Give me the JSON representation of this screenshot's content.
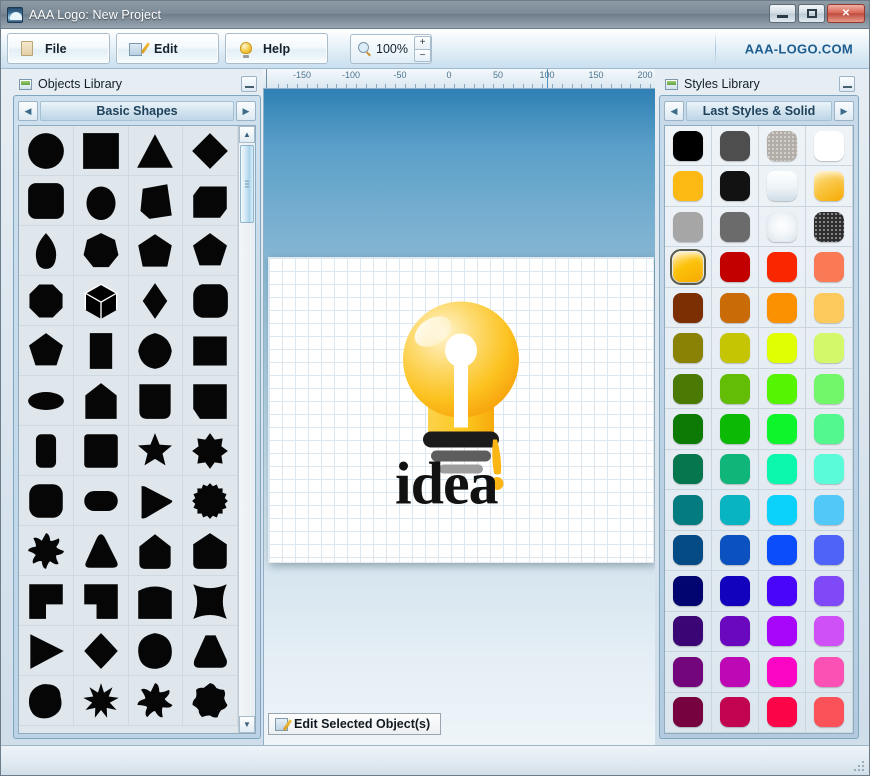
{
  "window": {
    "title": "AAA Logo: New Project",
    "icon": "app-logo-icon",
    "minimize_label": "",
    "maximize_label": "",
    "close_label": "✕"
  },
  "toolbar": {
    "buttons": [
      {
        "label": "File",
        "icon": "file-icon"
      },
      {
        "label": "Edit",
        "icon": "edit-pencil-icon"
      },
      {
        "label": "Help",
        "icon": "lightbulb-help-icon"
      }
    ],
    "zoom": {
      "icon": "magnifier-icon",
      "value": "100%",
      "increase": "+",
      "decrease": "−"
    },
    "brand": "AAA-LOGO.COM"
  },
  "objects_panel": {
    "title": "Objects Library",
    "icon": "library-icon",
    "collapse_label": "",
    "category": {
      "prev": "◀",
      "name": "Basic Shapes",
      "next": "▶"
    },
    "scrollbar": {
      "up": "▲",
      "down": "▼"
    },
    "shapes": [
      "circle",
      "square",
      "triangle",
      "diamond",
      "rounded-square",
      "egg",
      "cube-face",
      "slanted-hexagon",
      "teardrop",
      "heptagon",
      "pentagon-rounded",
      "pentagon",
      "octagon",
      "cube-3d",
      "rhombus",
      "rounded-octagon",
      "pentagon-wide",
      "rectangle-vertical",
      "hexagon-round",
      "rectangle-wide",
      "ellipse",
      "home-plate",
      "trapezoid-cup",
      "folded-square",
      "rounded-rect-tall",
      "square-rounded",
      "star-5",
      "star-8-blunt",
      "squircle",
      "pill-horizontal",
      "play-triangle",
      "gear-circle",
      "star-8-round",
      "triangle-rounded",
      "house",
      "shield",
      "step-corner",
      "step-notch",
      "arch-block",
      "concave-square",
      "arrow-right",
      "diamond-rounded",
      "blob-circle",
      "triangle-wide",
      "blob-petal",
      "star-9-sharp",
      "star-7-wave",
      "flower-blob"
    ]
  },
  "styles_panel": {
    "title": "Styles Library",
    "icon": "library-icon",
    "collapse_label": "",
    "category": {
      "prev": "◀",
      "name": "Last Styles & Solid",
      "next": "▶"
    },
    "swatches": [
      {
        "name": "black",
        "color": "#000000",
        "style": "solid",
        "selected": false
      },
      {
        "name": "dark-gray",
        "color": "#4e4e4e",
        "style": "solid",
        "selected": false
      },
      {
        "name": "light-gray-speck",
        "color": "#b2aea7",
        "style": "textured",
        "selected": false
      },
      {
        "name": "white",
        "color": "#ffffff",
        "style": "solid",
        "selected": false
      },
      {
        "name": "amber",
        "color": "#fdb913",
        "style": "solid",
        "selected": false
      },
      {
        "name": "near-black",
        "color": "#121212",
        "style": "solid",
        "selected": false
      },
      {
        "name": "white-gradient",
        "color": "#ffffff",
        "style": "gradient",
        "selected": false
      },
      {
        "name": "gold-gloss",
        "color": "#f9c747",
        "style": "gloss",
        "selected": false
      },
      {
        "name": "mid-gray",
        "color": "#a6a6a6",
        "style": "solid",
        "selected": false
      },
      {
        "name": "slate-gray",
        "color": "#6b6b6b",
        "style": "solid",
        "selected": false
      },
      {
        "name": "white-radial",
        "color": "#ffffff",
        "style": "radial",
        "selected": false
      },
      {
        "name": "charcoal-dots",
        "color": "#2e2e2e",
        "style": "textured",
        "selected": false
      },
      {
        "name": "gold-selected",
        "color": "#fcc20a",
        "style": "gloss",
        "selected": true
      },
      {
        "name": "dark-red",
        "color": "#c20000",
        "style": "solid",
        "selected": false
      },
      {
        "name": "red",
        "color": "#fa2600",
        "style": "solid",
        "selected": false
      },
      {
        "name": "salmon",
        "color": "#fa7a55",
        "style": "solid",
        "selected": false
      },
      {
        "name": "dark-brown",
        "color": "#7c2f02",
        "style": "solid",
        "selected": false
      },
      {
        "name": "burnt-orange",
        "color": "#c96b06",
        "style": "solid",
        "selected": false
      },
      {
        "name": "orange",
        "color": "#fb9000",
        "style": "solid",
        "selected": false
      },
      {
        "name": "light-orange",
        "color": "#fcc95c",
        "style": "solid",
        "selected": false
      },
      {
        "name": "olive",
        "color": "#8a8204",
        "style": "solid",
        "selected": false
      },
      {
        "name": "yellow-olive",
        "color": "#c6c504",
        "style": "solid",
        "selected": false
      },
      {
        "name": "chartreuse",
        "color": "#e0ff00",
        "style": "solid",
        "selected": false
      },
      {
        "name": "light-chartreuse",
        "color": "#d3f96a",
        "style": "solid",
        "selected": false
      },
      {
        "name": "dark-olive-green",
        "color": "#4a7a04",
        "style": "solid",
        "selected": false
      },
      {
        "name": "apple-green",
        "color": "#62bd04",
        "style": "solid",
        "selected": false
      },
      {
        "name": "bright-green",
        "color": "#55f400",
        "style": "solid",
        "selected": false
      },
      {
        "name": "light-green",
        "color": "#73f76a",
        "style": "solid",
        "selected": false
      },
      {
        "name": "forest-green",
        "color": "#0d7a06",
        "style": "solid",
        "selected": false
      },
      {
        "name": "green",
        "color": "#0cba05",
        "style": "solid",
        "selected": false
      },
      {
        "name": "lime",
        "color": "#0ef62b",
        "style": "solid",
        "selected": false
      },
      {
        "name": "mint",
        "color": "#52f88e",
        "style": "solid",
        "selected": false
      },
      {
        "name": "sea-green",
        "color": "#05764d",
        "style": "solid",
        "selected": false
      },
      {
        "name": "emerald",
        "color": "#10b57a",
        "style": "solid",
        "selected": false
      },
      {
        "name": "spring-green",
        "color": "#0bf7ab",
        "style": "solid",
        "selected": false
      },
      {
        "name": "aquamarine",
        "color": "#59fbd9",
        "style": "solid",
        "selected": false
      },
      {
        "name": "teal",
        "color": "#047b7e",
        "style": "solid",
        "selected": false
      },
      {
        "name": "dark-cyan",
        "color": "#09b4c2",
        "style": "solid",
        "selected": false
      },
      {
        "name": "cyan",
        "color": "#0ad2fb",
        "style": "solid",
        "selected": false
      },
      {
        "name": "sky-blue",
        "color": "#52c8f8",
        "style": "solid",
        "selected": false
      },
      {
        "name": "navy-blue",
        "color": "#044a84",
        "style": "solid",
        "selected": false
      },
      {
        "name": "medium-blue",
        "color": "#0b52c0",
        "style": "solid",
        "selected": false
      },
      {
        "name": "blue",
        "color": "#0b4cfb",
        "style": "solid",
        "selected": false
      },
      {
        "name": "cornflower",
        "color": "#4f63f8",
        "style": "solid",
        "selected": false
      },
      {
        "name": "dark-navy",
        "color": "#020470",
        "style": "solid",
        "selected": false
      },
      {
        "name": "dark-blue",
        "color": "#1302bd",
        "style": "solid",
        "selected": false
      },
      {
        "name": "violet-blue",
        "color": "#4905fa",
        "style": "solid",
        "selected": false
      },
      {
        "name": "purple-blue",
        "color": "#8049f7",
        "style": "solid",
        "selected": false
      },
      {
        "name": "dark-purple",
        "color": "#3b0575",
        "style": "solid",
        "selected": false
      },
      {
        "name": "purple",
        "color": "#6a08bf",
        "style": "solid",
        "selected": false
      },
      {
        "name": "violet",
        "color": "#a806fb",
        "style": "solid",
        "selected": false
      },
      {
        "name": "light-violet",
        "color": "#d050f8",
        "style": "solid",
        "selected": false
      },
      {
        "name": "dark-magenta",
        "color": "#74067c",
        "style": "solid",
        "selected": false
      },
      {
        "name": "magenta",
        "color": "#bd08b5",
        "style": "solid",
        "selected": false
      },
      {
        "name": "fuchsia",
        "color": "#fb06c4",
        "style": "solid",
        "selected": false
      },
      {
        "name": "pink",
        "color": "#fb51b5",
        "style": "solid",
        "selected": false
      },
      {
        "name": "maroon",
        "color": "#76023f",
        "style": "solid",
        "selected": false
      },
      {
        "name": "crimson",
        "color": "#c20450",
        "style": "solid",
        "selected": false
      },
      {
        "name": "rose-red",
        "color": "#fb0448",
        "style": "solid",
        "selected": false
      },
      {
        "name": "coral-red",
        "color": "#fb5159",
        "style": "solid",
        "selected": false
      }
    ]
  },
  "canvas": {
    "ruler": {
      "labels": [
        "-150",
        "-100",
        "-50",
        "0",
        "50",
        "100",
        "150",
        "200"
      ],
      "cursor_position": "100"
    },
    "logo": {
      "name": "idea-lightbulb-logo",
      "text": "idea",
      "exclamation": "!",
      "bulb_color": "#fdc52a",
      "bulb_highlight": "#fde8a6",
      "text_color": "#111111"
    }
  },
  "status": {
    "edit_button": "Edit Selected Object(s)",
    "icon": "edit-pencil-icon"
  }
}
